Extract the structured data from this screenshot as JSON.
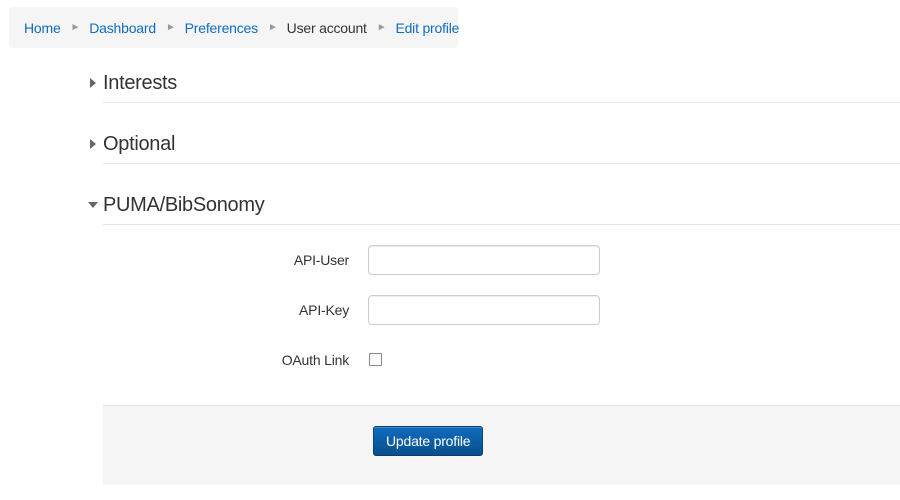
{
  "breadcrumb": {
    "items": [
      {
        "label": "Home",
        "link": true
      },
      {
        "label": "Dashboard",
        "link": true
      },
      {
        "label": "Preferences",
        "link": true
      },
      {
        "label": "User account",
        "link": false
      },
      {
        "label": "Edit profile",
        "link": true
      }
    ],
    "separator": "►"
  },
  "sections": {
    "interests": {
      "title": "Interests",
      "expanded": false
    },
    "optional": {
      "title": "Optional",
      "expanded": false
    },
    "puma": {
      "title": "PUMA/BibSonomy",
      "expanded": true
    }
  },
  "form": {
    "api_user": {
      "label": "API-User",
      "value": ""
    },
    "api_key": {
      "label": "API-Key",
      "value": ""
    },
    "oauth": {
      "label": "OAuth Link",
      "checked": false
    }
  },
  "actions": {
    "submit_label": "Update profile"
  },
  "colors": {
    "link": "#0f6cbf",
    "button": "#0f6cbf",
    "breadcrumb_bg": "#f5f5f5",
    "actions_bg": "#f5f5f5"
  }
}
